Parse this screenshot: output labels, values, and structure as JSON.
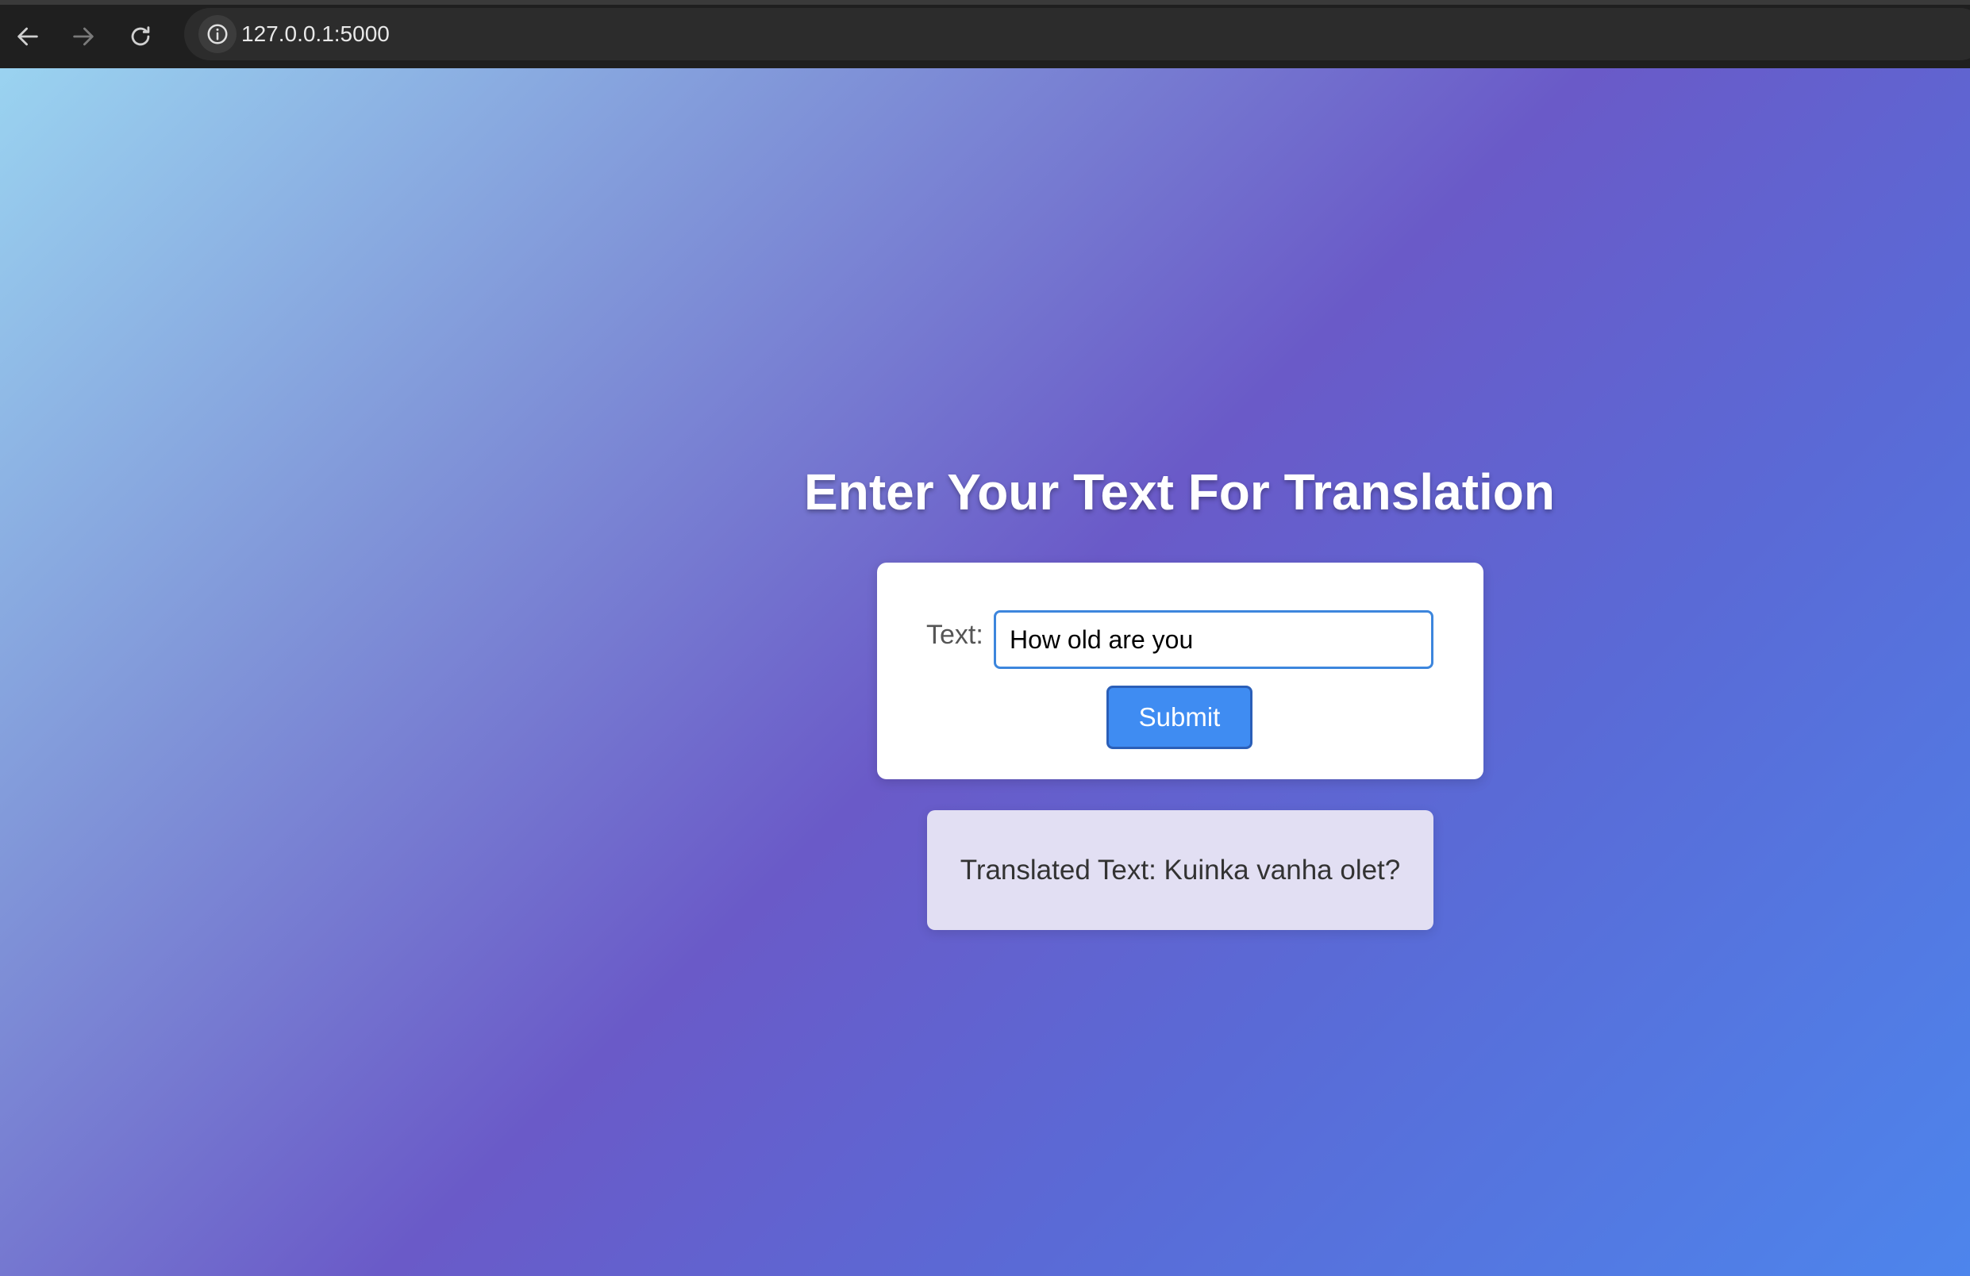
{
  "browser": {
    "url": "127.0.0.1:5000",
    "icons": {
      "back": "arrow-left-icon",
      "forward": "arrow-right-icon",
      "reload": "reload-icon",
      "site_info": "info-icon"
    }
  },
  "page": {
    "title": "Enter Your Text For Translation",
    "form": {
      "text_label": "Text:",
      "text_value": "How old are you",
      "submit_label": "Submit"
    },
    "result": {
      "text": "Translated Text: Kuinka vanha olet?"
    }
  },
  "colors": {
    "gradient_start": "#9ad3f0",
    "gradient_mid": "#6a5ac8",
    "gradient_end": "#4d85ec",
    "submit_button": "#3f8cf2",
    "input_border": "#3d86dd",
    "result_background": "#e2dff3"
  }
}
